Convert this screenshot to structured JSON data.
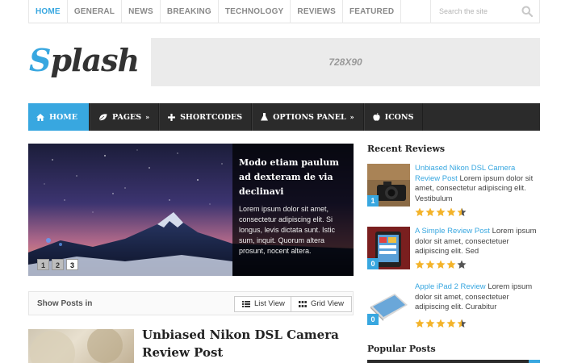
{
  "topnav": {
    "items": [
      {
        "label": "HOME"
      },
      {
        "label": "GENERAL"
      },
      {
        "label": "NEWS"
      },
      {
        "label": "BREAKING"
      },
      {
        "label": "TECHNOLOGY"
      },
      {
        "label": "REVIEWS"
      },
      {
        "label": "FEATURED"
      }
    ],
    "search_placeholder": "Search the site"
  },
  "header": {
    "logo_first": "S",
    "logo_rest": "plash",
    "ad_label": "728X90"
  },
  "mainnav": {
    "items": [
      {
        "label": "HOME",
        "icon": "home-icon"
      },
      {
        "label": "PAGES",
        "icon": "leaf-icon",
        "arrow": "»"
      },
      {
        "label": "SHORTCODES",
        "icon": "plus-icon"
      },
      {
        "label": "OPTIONS PANEL",
        "icon": "flask-icon",
        "arrow": "»"
      },
      {
        "label": "ICONS",
        "icon": "apple-icon"
      }
    ]
  },
  "slider": {
    "title": "Modo etiam paulum ad dexteram de via declinavi",
    "text": "Lorem ipsum dolor sit amet, consectetur adipiscing elit. Si longus, levis dictata sunt. Istic sum, inquit. Quorum altera prosunt, nocent altera.",
    "pages": [
      "1",
      "2",
      "3"
    ],
    "active_page": "3"
  },
  "posts_bar": {
    "label": "Show Posts in",
    "list_view": "List View",
    "grid_view": "Grid View"
  },
  "post": {
    "title": "Unbiased Nikon DSL Camera Review Post"
  },
  "sidebar": {
    "recent_title": "Recent Reviews",
    "reviews": [
      {
        "link": "Unbiased Nikon DSL Camera Review Post",
        "excerpt": "Lorem ipsum dolor sit amet, consectetur adipiscing elit. Vestibulum",
        "comments": "1",
        "rating": 4.5
      },
      {
        "link": "A Simple Review Post",
        "excerpt": "Lorem ipsum dolor sit amet, consectetuer adipiscing elit. Sed",
        "comments": "0",
        "rating": 4
      },
      {
        "link": "Apple iPad 2 Review",
        "excerpt": "Lorem ipsum dolor sit amet, consectetuer adipiscing elit. Curabitur",
        "comments": "0",
        "rating": 4.5
      }
    ],
    "popular_title": "Popular Posts"
  },
  "colors": {
    "accent": "#38a7e0",
    "nav_dark": "#2b2b2b",
    "star": "#f3b32a"
  }
}
